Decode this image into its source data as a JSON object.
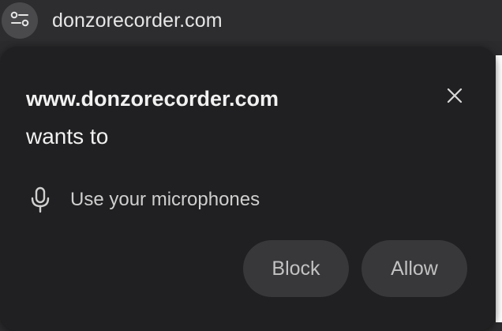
{
  "address_bar": {
    "url": "donzorecorder.com",
    "site_info_icon": "tune-icon"
  },
  "prompt": {
    "site": "www.donzorecorder.com",
    "wants_to": "wants to",
    "permission": {
      "icon": "microphone-icon",
      "label": "Use your microphones"
    },
    "close_icon": "close-icon",
    "buttons": {
      "block": "Block",
      "allow": "Allow"
    }
  },
  "colors": {
    "popup_background": "#202022",
    "button_background": "#38383b",
    "text_primary": "#f1f1f1"
  }
}
